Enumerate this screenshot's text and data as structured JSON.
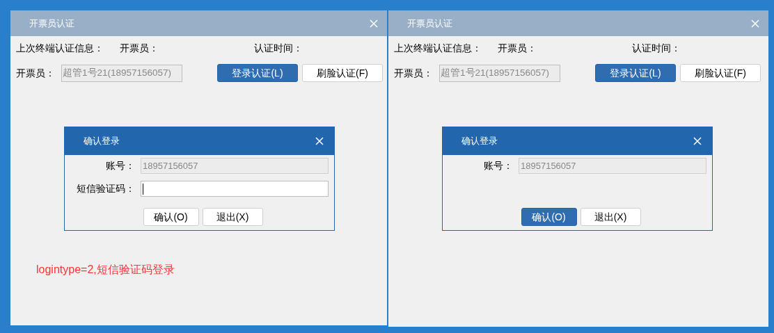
{
  "windows": [
    {
      "title": "开票员认证",
      "last_info_label": "上次终端认证信息：",
      "last_operator_label": "开票员：",
      "auth_time_label": "认证时间：",
      "operator_label": "开票员：",
      "operator_value": "超管1号21(18957156057)",
      "buttons": [
        {
          "label": "登录认证(L)",
          "primary": true
        },
        {
          "label": "刷脸认证(F)",
          "primary": false
        }
      ],
      "dialog": {
        "title": "确认登录",
        "fields": [
          {
            "label": "账号：",
            "value": "18957156057",
            "kind": "readonly",
            "focused": false
          },
          {
            "label": "短信验证码：",
            "kind": "input",
            "focused": true
          }
        ],
        "buttons": [
          {
            "label": "确认(O)",
            "primary": false
          },
          {
            "label": "退出(X)",
            "primary": false
          }
        ]
      },
      "note": "logintype=2,短信验证码登录"
    },
    {
      "title": "开票员认证",
      "last_info_label": "上次终端认证信息：",
      "last_operator_label": "开票员：",
      "auth_time_label": "认证时间：",
      "operator_label": "开票员：",
      "operator_value": "超管1号21(18957156057)",
      "buttons": [
        {
          "label": "登录认证(L)",
          "primary": true
        },
        {
          "label": "刷脸认证(F)",
          "primary": false
        }
      ],
      "dialog": {
        "title": "确认登录",
        "fields": [
          {
            "label": "账号：",
            "value": "18957156057",
            "kind": "readonly",
            "focused": false
          }
        ],
        "buttons": [
          {
            "label": "确认(O)",
            "primary": true
          },
          {
            "label": "退出(X)",
            "primary": false
          }
        ]
      }
    }
  ]
}
